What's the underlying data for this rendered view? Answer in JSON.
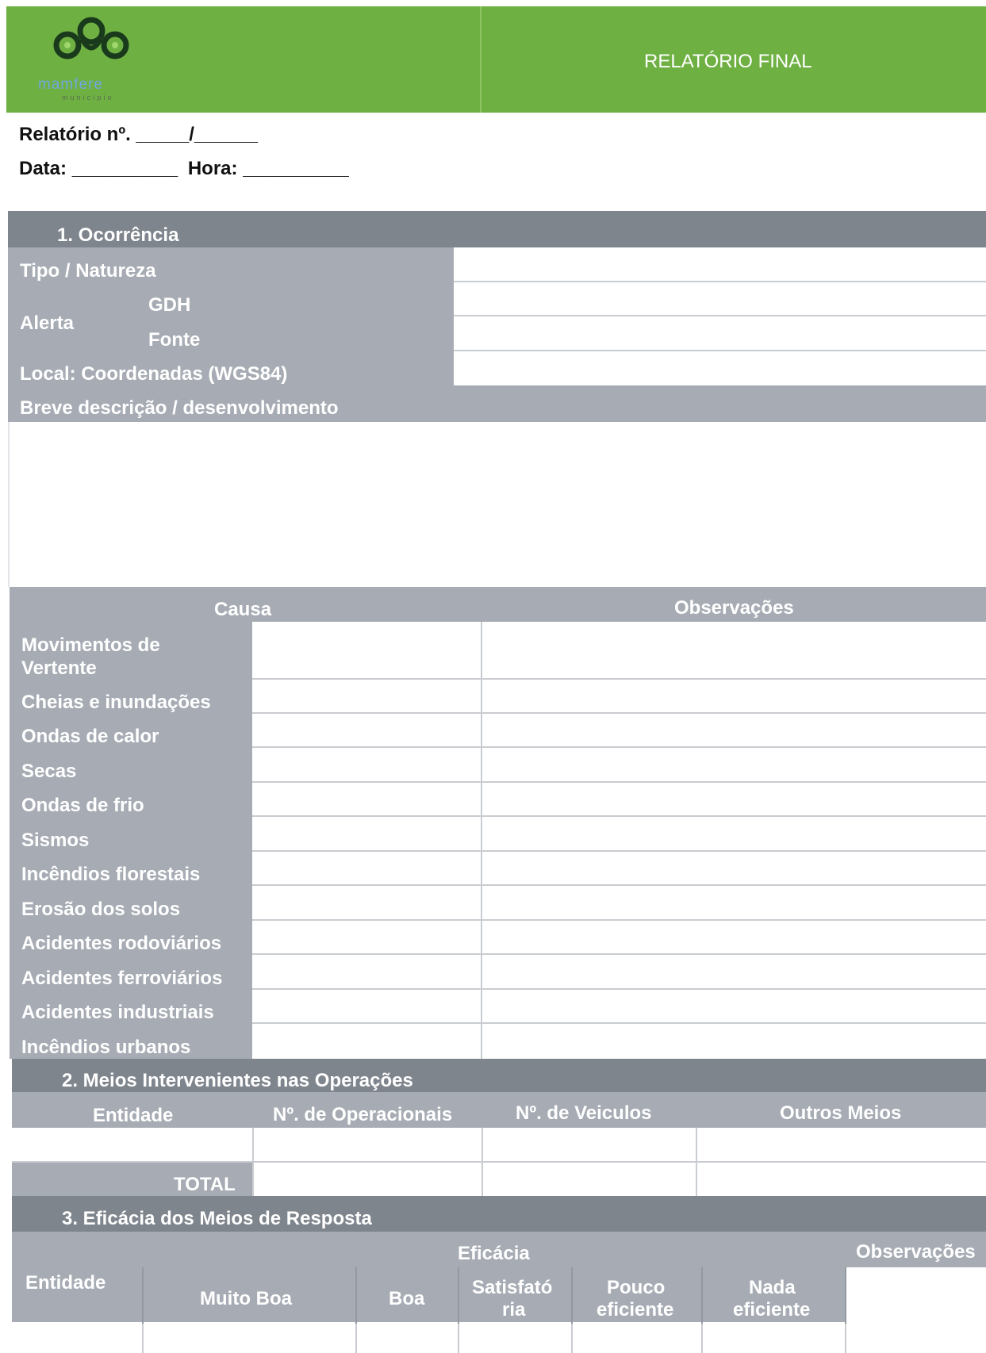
{
  "header": {
    "title": "RELATÓRIO FINAL",
    "logo_text": "mamfere",
    "logo_subtext": "município",
    "brand_color": "#6fb043"
  },
  "meta": {
    "report_label": "Relatório nº.",
    "report_blanks": "_____/______",
    "date_label": "Data:",
    "date_blank": "__________",
    "time_label": "Hora:",
    "time_blank": "__________"
  },
  "section1": {
    "title": "1.   Ocorrência",
    "fields": {
      "tipo": "Tipo / Natureza",
      "alerta": "Alerta",
      "gdh": "GDH",
      "fonte": "Fonte",
      "local": "Local: Coordenadas (WGS84)",
      "descricao": "Breve descrição / desenvolvimento"
    },
    "cause_header": "Causa",
    "obs_header": "Observações",
    "causes": [
      "Movimentos de",
      "Vertente",
      "Cheias e inundações",
      "Ondas de calor",
      "Secas",
      "Ondas de frio",
      "Sismos",
      "Incêndios florestais",
      "Erosão dos solos",
      "Acidentes rodoviários",
      "Acidentes ferroviários",
      "Acidentes industriais",
      "Incêndios urbanos"
    ]
  },
  "section2": {
    "title": "2.   Meios Intervenientes nas Operações",
    "columns": [
      "Entidade",
      "Nº. de Operacionais",
      "Nº. de Veiculos",
      "Outros Meios"
    ],
    "total_label": "TOTAL"
  },
  "section3": {
    "title": "3.   Eficácia dos Meios de Resposta",
    "entity_header": "Entidade",
    "efficacy_header": "Eficácia",
    "obs_header": "Observações",
    "levels": {
      "muito_boa": "Muito Boa",
      "boa": "Boa",
      "satisf_1": "Satisfató",
      "satisf_2": "ria",
      "pouco_1": "Pouco",
      "pouco_2": "eficiente",
      "nada_1": "Nada",
      "nada_2": "eficiente"
    }
  },
  "colors": {
    "header_green": "#6fb043",
    "section_bar": "#7f858d",
    "label_grey": "#a7acb4",
    "line": "#c9ccd0"
  }
}
